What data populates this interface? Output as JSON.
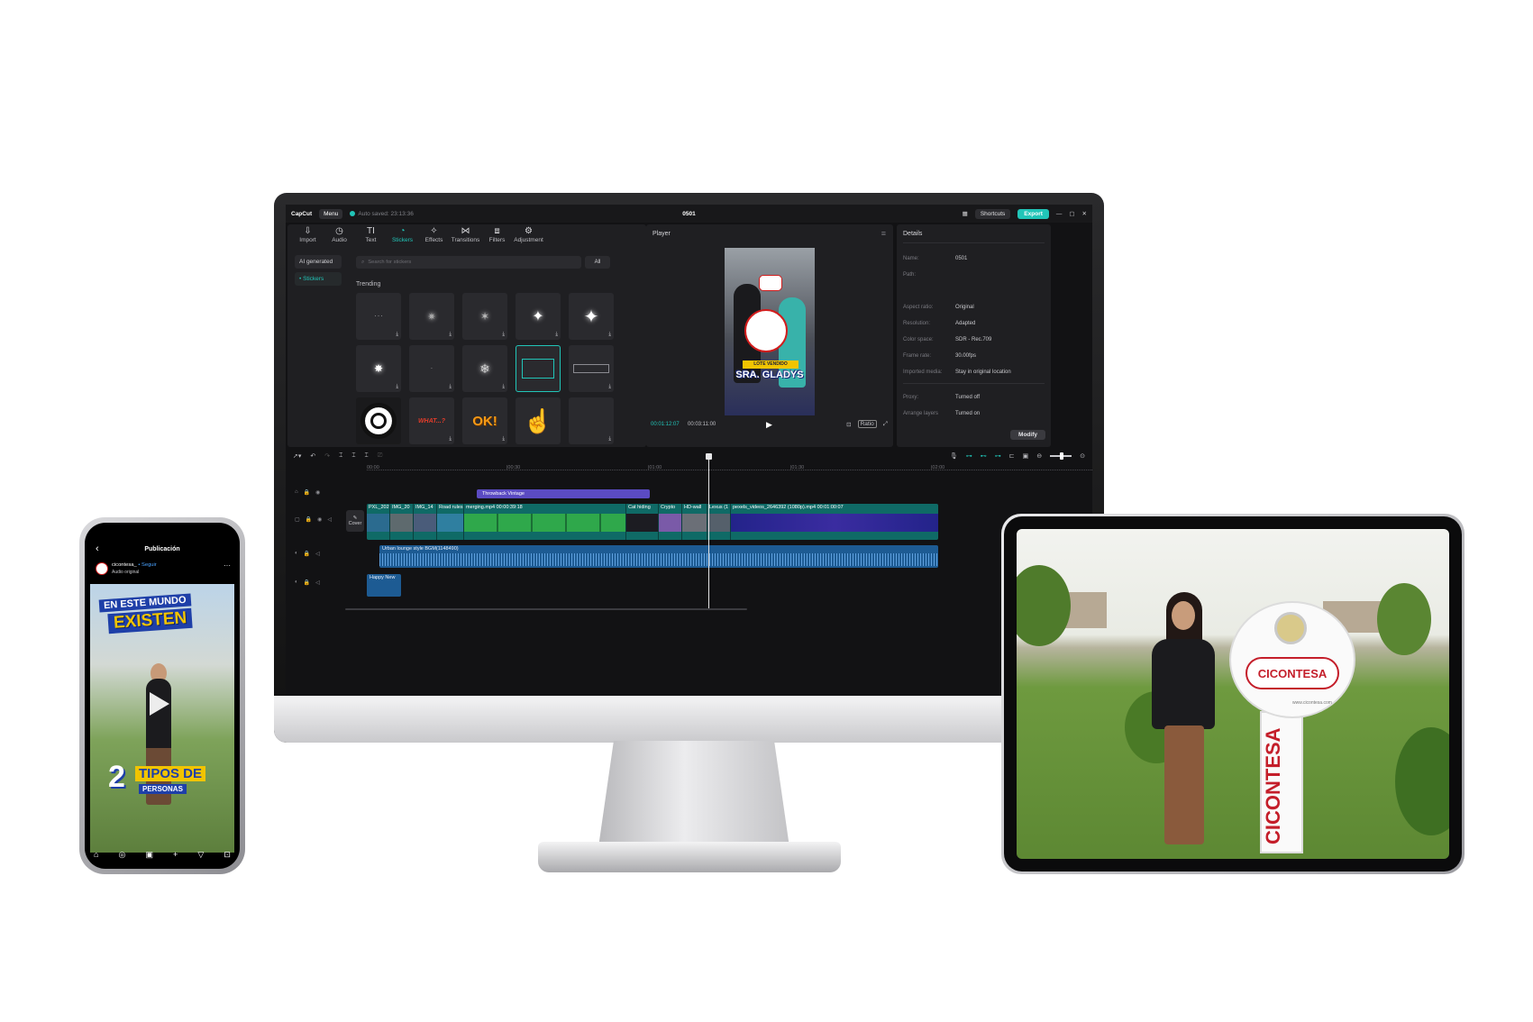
{
  "app": {
    "logo_text": "CapCut",
    "menu_label": "Menu",
    "autosave": "Auto saved: 23:13:36",
    "project_title": "0501",
    "shortcuts_label": "Shortcuts",
    "export_label": "Export",
    "window_controls": [
      "—",
      "▢",
      "✕"
    ]
  },
  "toolbar": {
    "tools": [
      {
        "label": "Import",
        "icon": "⇩"
      },
      {
        "label": "Audio",
        "icon": "◷"
      },
      {
        "label": "Text",
        "icon": "TI"
      },
      {
        "label": "Stickers",
        "icon": "◔"
      },
      {
        "label": "Effects",
        "icon": "✧"
      },
      {
        "label": "Transitions",
        "icon": "⋈"
      },
      {
        "label": "Filters",
        "icon": "⧈"
      },
      {
        "label": "Adjustment",
        "icon": "⚙"
      }
    ],
    "active_index": 3
  },
  "sidebar": {
    "items": [
      "AI generated",
      "• Stickers"
    ]
  },
  "library": {
    "search_placeholder": "Search for stickers",
    "filter_label": "All",
    "section_title": "Trending",
    "stickers_row3": [
      "WHAT...?",
      "OK!"
    ]
  },
  "player": {
    "title": "Player",
    "current_time": "00:01:12:07",
    "duration": "00:03:11:00",
    "ratio_label": "Ratio",
    "video_caption_small": "LOTE VENDIDO",
    "video_caption_big": "SRA. GLADYS"
  },
  "details": {
    "title": "Details",
    "rows": [
      {
        "key": "Name:",
        "value": "0501"
      },
      {
        "key": "Path:",
        "value": ""
      },
      {
        "key": "Aspect ratio:",
        "value": "Original"
      },
      {
        "key": "Resolution:",
        "value": "Adapted"
      },
      {
        "key": "Color space:",
        "value": "SDR - Rec.709"
      },
      {
        "key": "Frame rate:",
        "value": "30.00fps"
      },
      {
        "key": "Imported media:",
        "value": "Stay in original location"
      },
      {
        "key": "Proxy:",
        "value": "Turned off"
      },
      {
        "key": "Arrange layers",
        "value": "Turned on"
      }
    ],
    "modify_label": "Modify"
  },
  "timeline": {
    "ruler": [
      "00:00",
      "|00:30",
      "|01:00",
      "|01:30",
      "|02:00"
    ],
    "cover_label": "Cover",
    "effect_clip": "Throwback Vintage",
    "video_clips": [
      {
        "label": "PXL_202",
        "color": "#2b6b8f"
      },
      {
        "label": "IMG_20",
        "color": "#5e6a6e"
      },
      {
        "label": "IMG_14",
        "color": "#4a5c7a"
      },
      {
        "label": "Road rules",
        "color": "#2f7fa0"
      },
      {
        "label": "merging.mp4  00:00:39:18",
        "color": "#2fa84b"
      },
      {
        "label": "Cat hiding",
        "color": "#1c1c22"
      },
      {
        "label": "Crypto",
        "color": "#7a5aa8"
      },
      {
        "label": "HD-wall",
        "color": "#6b6f77"
      },
      {
        "label": "Lexus (1",
        "color": "#55606b"
      },
      {
        "label": "pexels_videos_2646392 (1080p).mp4  00:01:00:07",
        "color": "#23238a"
      }
    ],
    "audio_clip": "Urban lounge style BGM(1148490)",
    "audio_clip2": "Happy New"
  },
  "phone": {
    "header_title": "Publicación",
    "username": "cicontesa_",
    "follow": "• Seguir",
    "audio": "Audio original",
    "overlay_line1": "EN ESTE MUNDO",
    "overlay_line2": "EXISTEN",
    "big_number": "2",
    "overlay_line3": "TIPOS DE",
    "overlay_line4": "PERSONAS",
    "nav_icons": [
      "⌂",
      "◎",
      "▣",
      "+",
      "▽",
      "⊡"
    ]
  },
  "tablet": {
    "key_logo": "CICONTESA",
    "key_blade_text": "CICONTESA",
    "key_url": "www.cicontesa.com"
  },
  "colors": {
    "accent": "#21c5b8",
    "effect": "#5b4bc2",
    "video_track": "#0f6a66",
    "audio_track": "#1d5b93",
    "brand_red": "#c41e2a"
  }
}
